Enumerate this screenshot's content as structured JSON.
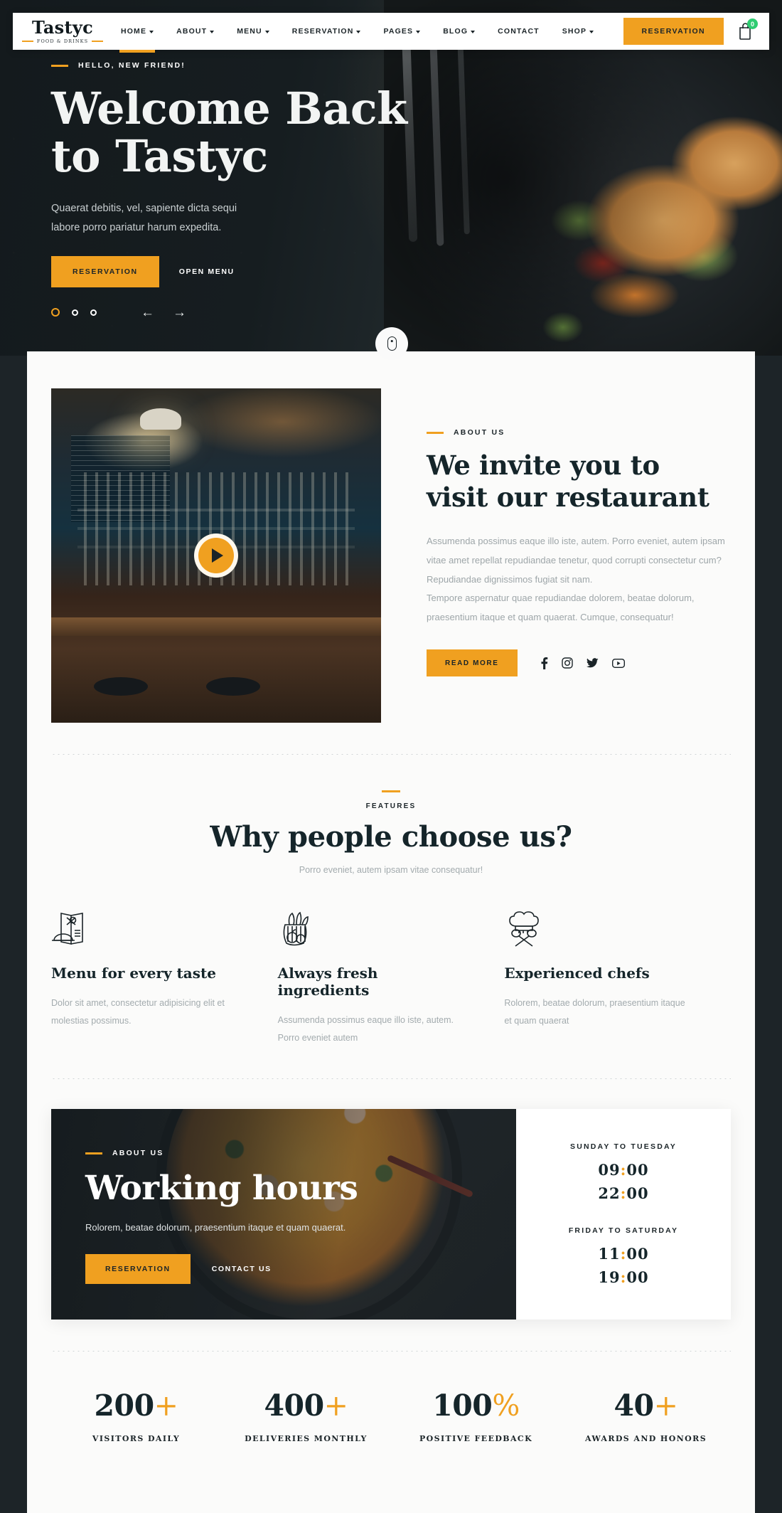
{
  "brand": {
    "name": "Tastyc",
    "tagline": "FOOD & DRINKS"
  },
  "header": {
    "nav": [
      {
        "label": "HOME",
        "caret": true,
        "active": true
      },
      {
        "label": "ABOUT",
        "caret": true,
        "active": false
      },
      {
        "label": "MENU",
        "caret": true,
        "active": false
      },
      {
        "label": "RESERVATION",
        "caret": true,
        "active": false
      },
      {
        "label": "PAGES",
        "caret": true,
        "active": false
      },
      {
        "label": "BLOG",
        "caret": true,
        "active": false
      },
      {
        "label": "CONTACT",
        "caret": false,
        "active": false
      },
      {
        "label": "SHOP",
        "caret": true,
        "active": false
      }
    ],
    "reservation_button": "RESERVATION",
    "cart_icon": "shopping-bag-icon",
    "cart_count": "0",
    "cart_badge_color": "#2ecc71"
  },
  "hero": {
    "eyebrow": "HELLO, NEW FRIEND!",
    "title_line1": "Welcome Back",
    "title_line2": "to Tastyc",
    "subtitle": "Quaerat debitis, vel, sapiente dicta sequi labore porro pariatur harum expedita.",
    "primary_button": "RESERVATION",
    "secondary_button": "OPEN MENU",
    "slides_total": 3,
    "active_slide": 1,
    "prev_arrow": "←",
    "next_arrow": "→",
    "scroll_icon": "mouse-scroll-icon"
  },
  "about": {
    "eyebrow": "ABOUT US",
    "title_line1": "We invite you to",
    "title_line2": "visit our restaurant",
    "paragraph1": "Assumenda possimus eaque illo iste, autem. Porro eveniet, autem ipsam vitae amet repellat repudiandae tenetur, quod corrupti consectetur cum? Repudiandae dignissimos fugiat sit nam.",
    "paragraph2": "Tempore aspernatur quae repudiandae dolorem, beatae dolorum, praesentium itaque et quam quaerat. Cumque, consequatur!",
    "read_more": "READ MORE",
    "play_icon": "play-button-icon",
    "socials": [
      {
        "name": "facebook-icon"
      },
      {
        "name": "instagram-icon"
      },
      {
        "name": "twitter-icon"
      },
      {
        "name": "youtube-icon"
      }
    ]
  },
  "features": {
    "eyebrow": "FEATURES",
    "title": "Why people choose us?",
    "description": "Porro eveniet, autem ipsam vitae consequatur!",
    "items": [
      {
        "icon": "menu-card-cloche-icon",
        "title": "Menu for every taste",
        "text": "Dolor sit amet, consectetur adipisicing elit et molestias possimus."
      },
      {
        "icon": "fresh-groceries-icon",
        "title": "Always fresh ingredients",
        "text": "Assumenda possimus eaque illo iste, autem. Porro eveniet autem"
      },
      {
        "icon": "chef-hat-utensils-icon",
        "title": "Experienced chefs",
        "text": "Rolorem, beatae dolorum, praesentium itaque et quam quaerat"
      }
    ]
  },
  "working_hours": {
    "eyebrow": "ABOUT US",
    "title": "Working hours",
    "description": "Rolorem, beatae dolorum, praesentium itaque et quam quaerat.",
    "primary_button": "RESERVATION",
    "secondary_button": "CONTACT US",
    "schedule": [
      {
        "days": "SUNDAY TO TUESDAY",
        "open": {
          "h": "09",
          "m": "00"
        },
        "close": {
          "h": "22",
          "m": "00"
        }
      },
      {
        "days": "FRIDAY TO SATURDAY",
        "open": {
          "h": "11",
          "m": "00"
        },
        "close": {
          "h": "19",
          "m": "00"
        }
      }
    ]
  },
  "stats": [
    {
      "value": "200",
      "symbol": "+",
      "label": "VISITORS DAILY"
    },
    {
      "value": "400",
      "symbol": "+",
      "label": "DELIVERIES MONTHLY"
    },
    {
      "value": "100",
      "symbol": "%",
      "label": "POSITIVE FEEDBACK"
    },
    {
      "value": "40",
      "symbol": "+",
      "label": "AWARDS AND HONORS"
    }
  ],
  "colors": {
    "accent": "#f0a020",
    "dark": "#15252a",
    "muted": "#a3abae",
    "sheet": "#fbfbfa",
    "badge_green": "#2ecc71"
  }
}
